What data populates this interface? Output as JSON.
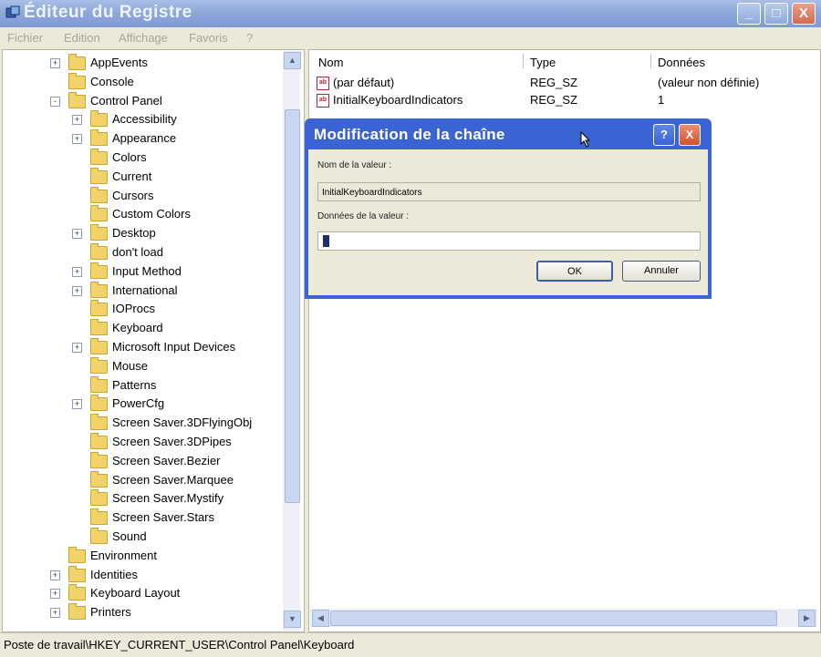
{
  "window": {
    "title": "Éditeur du Registre",
    "controls": {
      "minimize": "_",
      "maximize": "□",
      "close": "X"
    }
  },
  "menu": [
    "Fichier",
    "Edition",
    "Affichage",
    "Favoris",
    "?"
  ],
  "tree": [
    {
      "label": "AppEvents",
      "expander": "+"
    },
    {
      "label": "Console",
      "expander": ""
    },
    {
      "label": "Control Panel",
      "expander": "-"
    },
    {
      "label": "Accessibility",
      "expander": "+"
    },
    {
      "label": "Appearance",
      "expander": "+"
    },
    {
      "label": "Colors",
      "expander": ""
    },
    {
      "label": "Current",
      "expander": ""
    },
    {
      "label": "Cursors",
      "expander": ""
    },
    {
      "label": "Custom Colors",
      "expander": ""
    },
    {
      "label": "Desktop",
      "expander": "+"
    },
    {
      "label": "don't load",
      "expander": ""
    },
    {
      "label": "Input Method",
      "expander": "+"
    },
    {
      "label": "International",
      "expander": "+"
    },
    {
      "label": "IOProcs",
      "expander": ""
    },
    {
      "label": "Keyboard",
      "expander": ""
    },
    {
      "label": "Microsoft Input Devices",
      "expander": "+"
    },
    {
      "label": "Mouse",
      "expander": ""
    },
    {
      "label": "Patterns",
      "expander": ""
    },
    {
      "label": "PowerCfg",
      "expander": "+"
    },
    {
      "label": "Screen Saver.3DFlyingObj",
      "expander": ""
    },
    {
      "label": "Screen Saver.3DPipes",
      "expander": ""
    },
    {
      "label": "Screen Saver.Bezier",
      "expander": ""
    },
    {
      "label": "Screen Saver.Marquee",
      "expander": ""
    },
    {
      "label": "Screen Saver.Mystify",
      "expander": ""
    },
    {
      "label": "Screen Saver.Stars",
      "expander": ""
    },
    {
      "label": "Sound",
      "expander": ""
    },
    {
      "label": "Environment",
      "expander": ""
    },
    {
      "label": "Identities",
      "expander": "+"
    },
    {
      "label": "Keyboard Layout",
      "expander": "+"
    },
    {
      "label": "Printers",
      "expander": "+"
    }
  ],
  "list": {
    "headers": {
      "name": "Nom",
      "type": "Type",
      "data": "Données"
    },
    "rows": [
      {
        "name": "(par défaut)",
        "type": "REG_SZ",
        "data": "(valeur non définie)"
      },
      {
        "name": "InitialKeyboardIndicators",
        "type": "REG_SZ",
        "data": "1"
      }
    ]
  },
  "dialog": {
    "title": "Modification de la chaîne",
    "help": "?",
    "close": "X",
    "name_label": "Nom de la valeur :",
    "name_value": "InitialKeyboardIndicators",
    "data_label": "Données de la valeur :",
    "data_value": "",
    "ok": "OK",
    "cancel": "Annuler"
  },
  "status": "Poste de travail\\HKEY_CURRENT_USER\\Control Panel\\Keyboard",
  "colors": {
    "title_bar": "#8ea8da",
    "dialog_title": "#3a63d4",
    "close_button": "#d4694d",
    "folder": "#f2d36a"
  },
  "icons": {
    "app": "regedit-icon",
    "folder": "folder-icon",
    "value": "reg-sz-icon",
    "cursor": "mouse-cursor-icon"
  }
}
